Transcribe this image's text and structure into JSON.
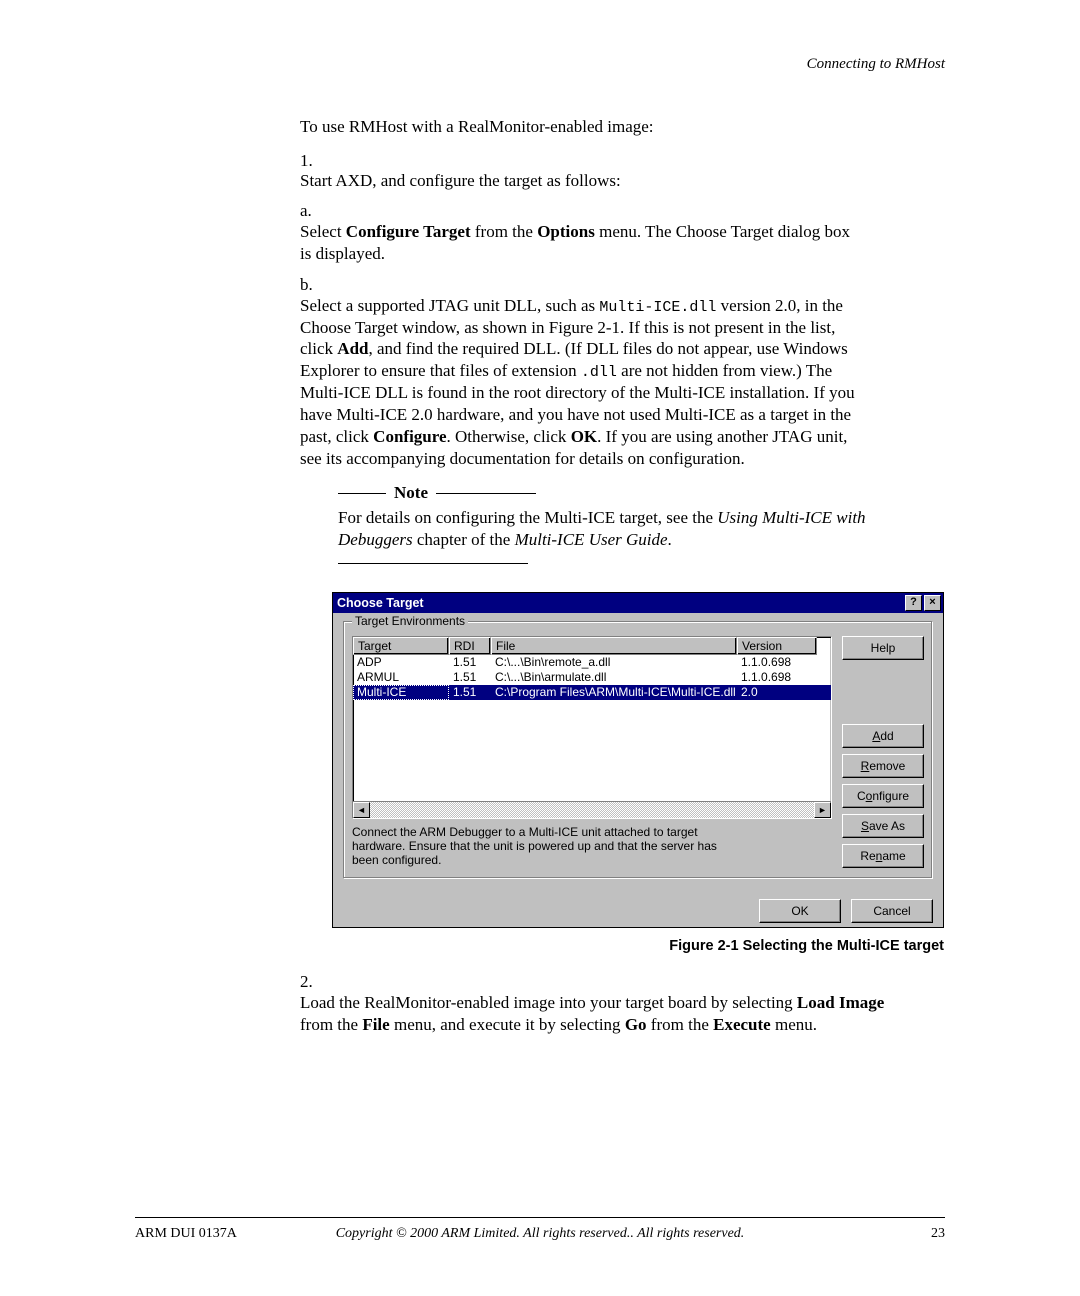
{
  "header": {
    "section": "Connecting to RMHost"
  },
  "intro": "To use RMHost with a RealMonitor-enabled image:",
  "step1": {
    "num": "1.",
    "lead": "Start AXD, and configure the target as follows:",
    "a": {
      "letter": "a.",
      "pre": "Select ",
      "b1": "Configure Target",
      "mid": " from the ",
      "b2": "Options",
      "post": " menu. The Choose Target dialog box is displayed."
    },
    "b": {
      "letter": "b.",
      "t1": "Select a supported JTAG unit DLL, such as ",
      "code1": "Multi-ICE.dll",
      "t2": " version 2.0, in the Choose Target window, as shown in Figure 2-1. If this is not present in the list, click ",
      "b1": "Add",
      "t3": ", and find the required DLL. (If DLL files do not appear, use Windows Explorer to ensure that files of extension ",
      "code2": ".dll",
      "t4": " are not hidden from view.) The Multi-ICE DLL is found in the root directory of the Multi-ICE installation. If you have Multi-ICE 2.0 hardware, and you have not used Multi-ICE as a target in the past, click ",
      "b2": "Configure",
      "t5": ". Otherwise, click ",
      "b3": "OK",
      "t6": ". If you are using another JTAG unit, see its accompanying documentation for details on configuration."
    }
  },
  "note": {
    "label": "Note",
    "t1": "For details on configuring the Multi-ICE target, see the ",
    "i1": "Using Multi-ICE with Debuggers",
    "t2": " chapter of the ",
    "i2": "Multi-ICE User Guide",
    "t3": "."
  },
  "dialog": {
    "title": "Choose Target",
    "help_btn": "?",
    "close_btn": "×",
    "group": "Target Environments",
    "columns": {
      "target": "Target",
      "rdi": "RDI",
      "file": "File",
      "version": "Version"
    },
    "rows": [
      {
        "target": "ADP",
        "rdi": "1.51",
        "file": "C:\\...\\Bin\\remote_a.dll",
        "version": "1.1.0.698"
      },
      {
        "target": "ARMUL",
        "rdi": "1.51",
        "file": "C:\\...\\Bin\\armulate.dll",
        "version": "1.1.0.698"
      },
      {
        "target": "Multi-ICE",
        "rdi": "1.51",
        "file": "C:\\Program Files\\ARM\\Multi-ICE\\Multi-ICE.dll",
        "version": "2.0"
      }
    ],
    "buttons": {
      "help": "Help",
      "add": "Add",
      "remove": "Remove",
      "configure": "Configure",
      "save_as": "Save As",
      "rename": "Rename",
      "ok": "OK",
      "cancel": "Cancel"
    },
    "description": "Connect the ARM Debugger to a Multi-ICE unit attached to target hardware.  Ensure that the unit is powered up and that the server has been configured."
  },
  "figure_caption": "Figure 2-1 Selecting the Multi-ICE target",
  "step2": {
    "num": "2.",
    "t1": "Load the RealMonitor-enabled image into your target board by selecting ",
    "b1": "Load Image",
    "t2": " from the ",
    "b2": "File",
    "t3": " menu, and execute it by selecting ",
    "b3": "Go",
    "t4": " from the ",
    "b4": "Execute",
    "t5": " menu."
  },
  "footer": {
    "left": "ARM DUI 0137A",
    "center": "Copyright © 2000 ARM Limited. All rights reserved.. All rights reserved.",
    "right": "23"
  }
}
